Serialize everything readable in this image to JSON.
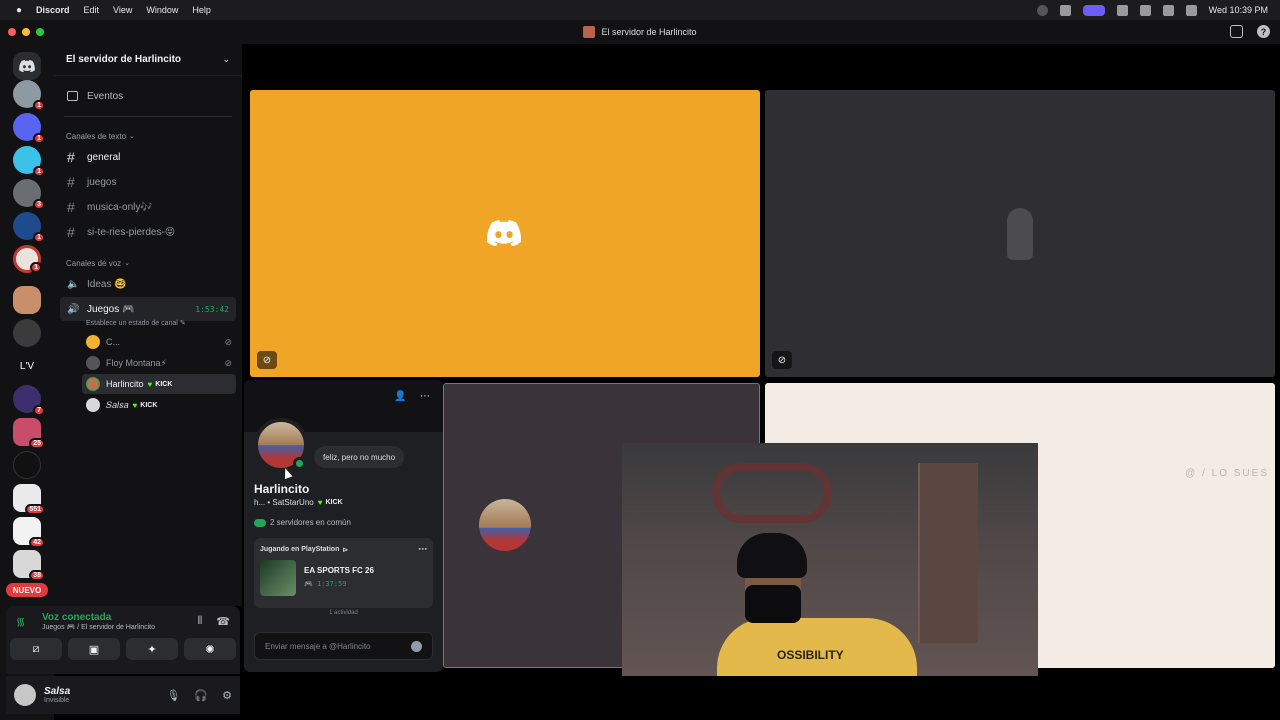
{
  "menubar": {
    "apple": "",
    "items": [
      "Discord",
      "Edit",
      "View",
      "Window",
      "Help"
    ],
    "clock": "Wed 10:39 PM"
  },
  "window": {
    "title": "El servidor de Harlincito"
  },
  "rail": {
    "badges": [
      "1",
      "1",
      "1",
      "3",
      "1",
      "1",
      "7",
      "25",
      "551",
      "42",
      "38"
    ],
    "text_server": "L'V",
    "new_label": "NUEVO"
  },
  "sidebar": {
    "server_name": "El servidor de Harlincito",
    "events_label": "Eventos",
    "text_category": "Canales de texto",
    "text_channels": [
      "general",
      "juegos",
      "musica-only🎶",
      "si-te-ries-pierdes-😝"
    ],
    "voice_category": "Canales de voz",
    "voice_channels": {
      "ideas": "Ideas 🤓",
      "juegos": "Juegos 🎮",
      "juegos_timer": "1:53:42",
      "juegos_status": "Establece un estado de canal"
    },
    "voice_users": [
      {
        "name": "C..."
      },
      {
        "name": "Floy Montana⚡"
      },
      {
        "name": "Harlincito",
        "badge": "KICK"
      },
      {
        "name": "𝑆𝑎𝑙𝑠𝑎",
        "badge": "KICK"
      }
    ]
  },
  "voice_panel": {
    "title": "Voz conectada",
    "subtitle": "Juegos 🎮 / El servidor de Harlincito"
  },
  "user_panel": {
    "name": "Salsa",
    "status": "Invisible"
  },
  "popout": {
    "status_bubble": "feliz, pero no mucho",
    "name": "Harlincito",
    "tag_prefix": "h... • SatStarUno",
    "tag_badge": "KICK",
    "mutual": "2 servidores en común",
    "activity_header": "Jugando en PlayStation",
    "game_name": "EA SPORTS FC 26",
    "game_time": "1:37:59",
    "activity_footer": "1 actividad",
    "message_placeholder": "Enviar mensaje a @Harlincito"
  },
  "stage": {
    "watermark": "@ / LO SUES"
  },
  "webcam": {
    "hoodie_text": "OSSIBILITY"
  },
  "colors": {
    "accent_green": "#23a55a",
    "tile_orange": "#f1a527",
    "badge_red": "#e03b3f",
    "kick_green": "#53fc18"
  }
}
